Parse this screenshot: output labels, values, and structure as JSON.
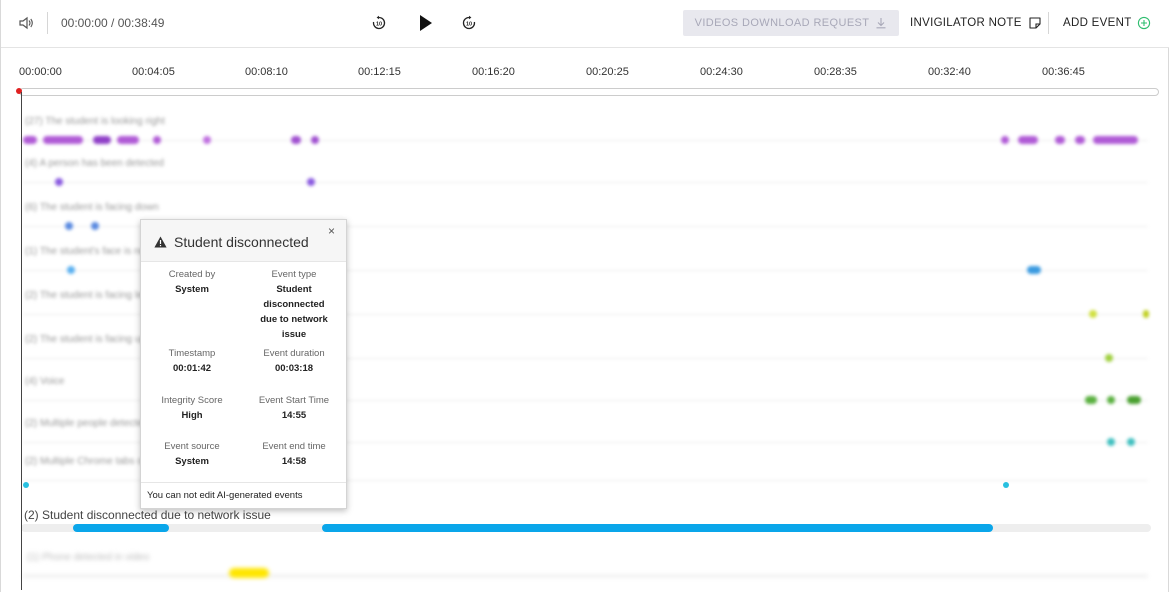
{
  "toolbar": {
    "volume_icon": "speaker-icon",
    "time_display": "00:00:00 / 00:38:49",
    "rewind_icon": "rewind-10-icon",
    "play_icon": "play-icon",
    "forward_icon": "forward-10-icon",
    "download_label": "VIDEOS DOWNLOAD REQUEST",
    "download_icon": "download-icon",
    "note_label": "INVIGILATOR NOTE",
    "note_icon": "note-icon",
    "add_label": "ADD EVENT",
    "add_icon": "plus-circle-icon",
    "add_icon_color": "#2dbd6e",
    "download_disabled": true
  },
  "ruler": {
    "ticks": [
      "00:00:00",
      "00:04:05",
      "00:08:10",
      "00:12:15",
      "00:16:20",
      "00:20:25",
      "00:24:30",
      "00:28:35",
      "00:32:40",
      "00:36:45"
    ]
  },
  "blurred_rows": {
    "labels": [
      "(27) The student is looking right",
      "(4) A person has been detected",
      "(6) The student is facing down",
      "(1) The student's face is not visible",
      "(2) The student is facing left",
      "(2) The student is facing up",
      "(4) Voice",
      "(2) Multiple people detected",
      "(2) Multiple Chrome tabs opened"
    ],
    "colors": [
      "#b05ad6",
      "#8a5ae0",
      "#5a8ae0",
      "#5ab0f0",
      "#3aa0f0",
      "#d0e040",
      "#a0d040",
      "#5ab040",
      "#40c0c0"
    ]
  },
  "focus_row": {
    "label": "(2) Student disconnected due to network issue",
    "bar_color": "#0aa6ea",
    "bottom_label": "(1) Phone detected in video"
  },
  "popup": {
    "title": "Student disconnected",
    "warn_icon": "warning-icon",
    "close_label": "×",
    "created_by_label": "Created by",
    "created_by": "System",
    "event_type_label": "Event type",
    "event_type": "Student disconnected due to network issue",
    "timestamp_label": "Timestamp",
    "timestamp": "00:01:42",
    "duration_label": "Event duration",
    "duration": "00:03:18",
    "integrity_label": "Integrity Score",
    "integrity": "High",
    "start_label": "Event Start Time",
    "start": "14:55",
    "source_label": "Event source",
    "source": "System",
    "end_label": "Event end time",
    "end": "14:58",
    "footer": "You can not edit AI-generated events"
  }
}
